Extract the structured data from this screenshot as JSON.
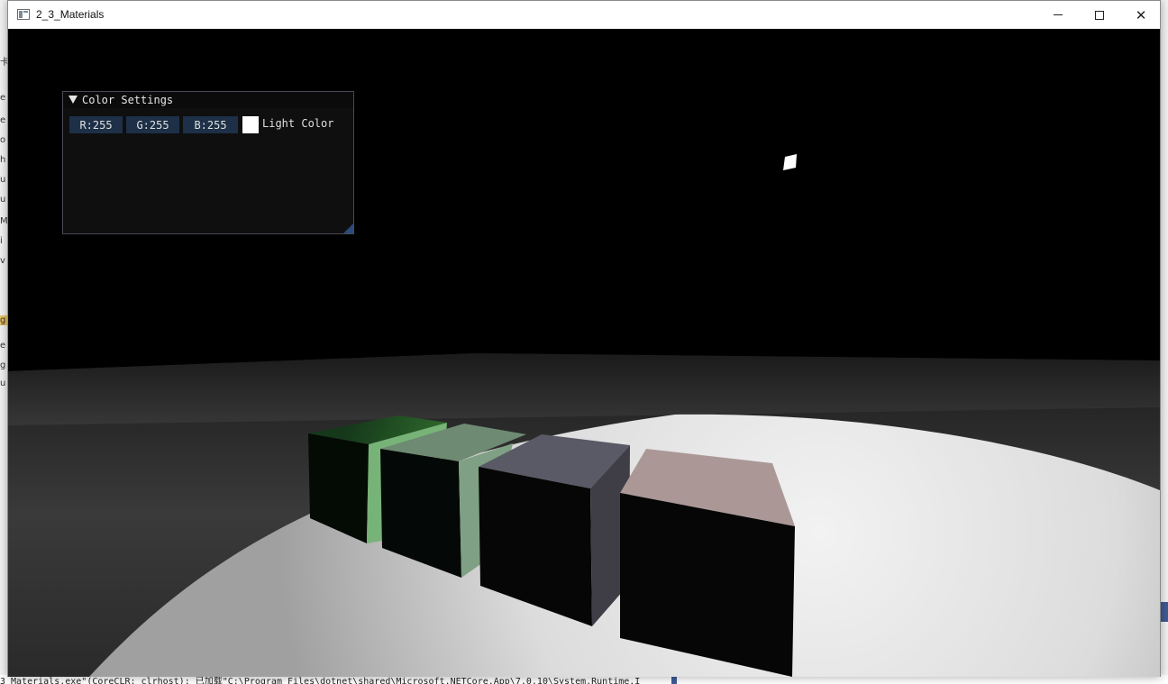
{
  "window": {
    "title": "2_3_Materials"
  },
  "imgui": {
    "panel_title": "Color Settings",
    "r_value": "R:255",
    "g_value": "G:255",
    "b_value": "B:255",
    "swatch_color": "#ffffff",
    "label": "Light Color"
  },
  "scene": {
    "light_color": "#ffffff",
    "cubes": [
      {
        "name": "green-cube",
        "color": "#4e8c4a"
      },
      {
        "name": "sage-cube",
        "color": "#7d9a82"
      },
      {
        "name": "slate-cube",
        "color": "#575660"
      },
      {
        "name": "rose-cube",
        "color": "#ab9896"
      }
    ]
  },
  "background": {
    "console_text": "3_Materials.exe\"(CoreCLR: clrhost): 已加载\"C:\\Program Files\\dotnet\\shared\\Microsoft.NETCore.App\\7.0.10\\System.Runtime.I"
  }
}
